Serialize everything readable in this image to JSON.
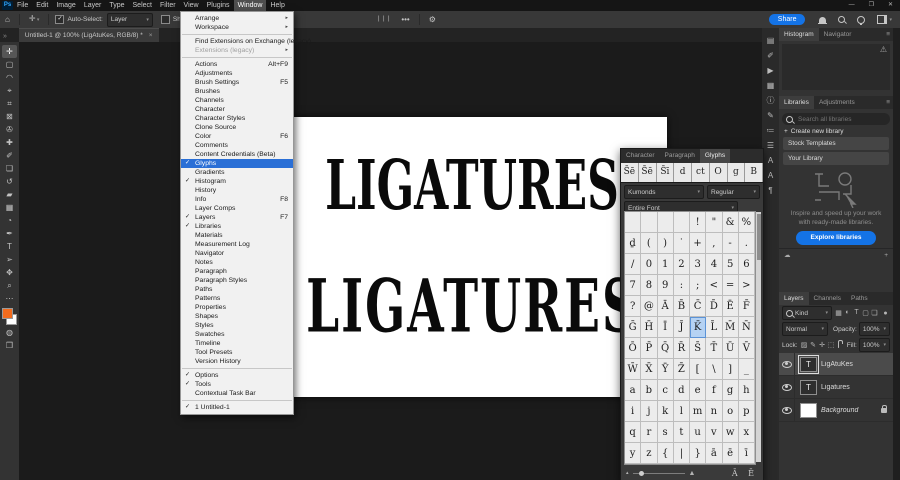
{
  "app": {
    "logo": "Ps"
  },
  "menubar": {
    "items": [
      "File",
      "Edit",
      "Image",
      "Layer",
      "Type",
      "Select",
      "Filter",
      "View",
      "Plugins",
      "Window",
      "Help"
    ],
    "active": "Window"
  },
  "options_bar": {
    "auto_select_label": "Auto-Select:",
    "auto_select_value": "Layer",
    "show_transform_label": "Show Transform Controls",
    "align_icons": "❘❘❘",
    "more_label": "•••",
    "share_label": "Share"
  },
  "document_tab": {
    "title": "Untitled-1 @ 100% (LigAtuKes, RGB/8) *",
    "close": "×"
  },
  "toolbar": {
    "foreground_color": "#f26b1d",
    "background_color": "#ffffff",
    "tools": [
      {
        "name": "move-tool",
        "glyph": "✛"
      },
      {
        "name": "marquee-tool",
        "glyph": "▢"
      },
      {
        "name": "lasso-tool",
        "glyph": "◠"
      },
      {
        "name": "object-selection-tool",
        "glyph": "⌖"
      },
      {
        "name": "crop-tool",
        "glyph": "⌗"
      },
      {
        "name": "frame-tool",
        "glyph": "⊠"
      },
      {
        "name": "eyedropper-tool",
        "glyph": "✇"
      },
      {
        "name": "healing-brush-tool",
        "glyph": "✚"
      },
      {
        "name": "brush-tool",
        "glyph": "✐"
      },
      {
        "name": "clone-stamp-tool",
        "glyph": "❏"
      },
      {
        "name": "history-brush-tool",
        "glyph": "↺"
      },
      {
        "name": "eraser-tool",
        "glyph": "▰"
      },
      {
        "name": "gradient-tool",
        "glyph": "▦"
      },
      {
        "name": "blur-tool",
        "glyph": "◔"
      },
      {
        "name": "pen-tool",
        "glyph": "✒"
      },
      {
        "name": "type-tool",
        "glyph": "T"
      },
      {
        "name": "path-selection-tool",
        "glyph": "➢"
      },
      {
        "name": "hand-tool",
        "glyph": "✥"
      },
      {
        "name": "zoom-tool",
        "glyph": "⌕"
      },
      {
        "name": "edit-toolbar",
        "glyph": "⋯"
      }
    ]
  },
  "canvas": {
    "line1": "LIGATURES",
    "line2": "LIGATURES"
  },
  "window_menu": {
    "items": [
      {
        "label": "Arrange",
        "submenu": true
      },
      {
        "label": "Workspace",
        "submenu": true
      },
      {
        "sep": true
      },
      {
        "label": "Find Extensions on Exchange (legacy)..."
      },
      {
        "label": "Extensions (legacy)",
        "submenu": true,
        "disabled": true
      },
      {
        "sep": true
      },
      {
        "label": "Actions",
        "shortcut": "Alt+F9"
      },
      {
        "label": "Adjustments"
      },
      {
        "label": "Brush Settings",
        "shortcut": "F5"
      },
      {
        "label": "Brushes"
      },
      {
        "label": "Channels"
      },
      {
        "label": "Character"
      },
      {
        "label": "Character Styles"
      },
      {
        "label": "Clone Source"
      },
      {
        "label": "Color",
        "shortcut": "F6"
      },
      {
        "label": "Comments"
      },
      {
        "label": "Content Credentials (Beta)"
      },
      {
        "label": "Glyphs",
        "checked": true,
        "highlighted": true
      },
      {
        "label": "Gradients"
      },
      {
        "label": "Histogram",
        "checked": true
      },
      {
        "label": "History"
      },
      {
        "label": "Info",
        "shortcut": "F8"
      },
      {
        "label": "Layer Comps"
      },
      {
        "label": "Layers",
        "checked": true,
        "shortcut": "F7"
      },
      {
        "label": "Libraries",
        "checked": true
      },
      {
        "label": "Materials"
      },
      {
        "label": "Measurement Log"
      },
      {
        "label": "Navigator"
      },
      {
        "label": "Notes"
      },
      {
        "label": "Paragraph"
      },
      {
        "label": "Paragraph Styles"
      },
      {
        "label": "Paths"
      },
      {
        "label": "Patterns"
      },
      {
        "label": "Properties"
      },
      {
        "label": "Shapes"
      },
      {
        "label": "Styles"
      },
      {
        "label": "Swatches"
      },
      {
        "label": "Timeline"
      },
      {
        "label": "Tool Presets"
      },
      {
        "label": "Version History"
      },
      {
        "sep": true
      },
      {
        "label": "Options",
        "checked": true
      },
      {
        "label": "Tools",
        "checked": true
      },
      {
        "label": "Contextual Task Bar"
      },
      {
        "sep": true
      },
      {
        "label": "1 Untitled-1",
        "checked": true
      }
    ]
  },
  "glyphs_panel": {
    "tabs": [
      "Glyphs",
      "Character",
      "Paragraph"
    ],
    "active_tab": "Glyphs",
    "recent_glyphs": [
      "S̄ē",
      "S̄ē",
      "S̄ī",
      "d",
      "ct",
      "O",
      "g",
      "B"
    ],
    "font_name": "Kumonds",
    "font_style": "Regular",
    "scope": "Entire Font",
    "grid": [
      [
        "",
        "",
        "",
        "",
        "!",
        "\"",
        "&",
        "%"
      ],
      [
        "ḏ",
        "(",
        ")",
        "˙",
        "+",
        ",",
        "-",
        "."
      ],
      [
        "/",
        "0",
        "1",
        "2",
        "3",
        "4",
        "5",
        "6"
      ],
      [
        "7",
        "8",
        "9",
        ":",
        ";",
        "<",
        "=",
        ">"
      ],
      [
        "?",
        "@",
        "Ā",
        "B̄",
        "C̄",
        "D̄",
        "Ē",
        "F̄"
      ],
      [
        "Ḡ",
        "H̄",
        "Ī",
        "J̄",
        "K̄",
        "L̄",
        "M̄",
        "N̄"
      ],
      [
        "Ō",
        "P̄",
        "Q̄",
        "R̄",
        "S̄",
        "T̄",
        "Ū",
        "V̄"
      ],
      [
        "W̄",
        "X̄",
        "Ȳ",
        "Z̄",
        "[",
        "\\",
        "]",
        "_"
      ],
      [
        "a",
        "b",
        "c",
        "d",
        "e",
        "f",
        "g",
        "h"
      ],
      [
        "i",
        "j",
        "k",
        "l",
        "m",
        "n",
        "o",
        "p"
      ],
      [
        "q",
        "r",
        "s",
        "t",
        "u",
        "v",
        "w",
        "x"
      ],
      [
        "y",
        "z",
        "{",
        "|",
        "}",
        "ā",
        "ē",
        "ī"
      ]
    ],
    "selected_cell": {
      "row": 5,
      "col": 4
    },
    "preview_glyphs": "Ā Ē"
  },
  "right_strip": {
    "icons": [
      {
        "name": "collapsed-clone-source-icon",
        "glyph": "▤"
      },
      {
        "name": "collapsed-brush-settings-icon",
        "glyph": "✐"
      },
      {
        "name": "collapsed-actions-icon",
        "glyph": "▶"
      },
      {
        "name": "collapsed-stock-icon",
        "glyph": "▦"
      },
      {
        "name": "collapsed-info-icon",
        "glyph": "ⓘ"
      },
      {
        "name": "collapsed-brush-icon",
        "glyph": "✎"
      },
      {
        "name": "collapsed-properties-icon",
        "glyph": "≔"
      },
      {
        "name": "collapsed-comments-icon",
        "glyph": "☰"
      },
      {
        "name": "collapsed-character-styles-icon",
        "glyph": "A"
      },
      {
        "name": "collapsed-paragraph-styles-icon",
        "glyph": "A"
      },
      {
        "name": "collapsed-paragraph-icon",
        "glyph": "¶"
      }
    ]
  },
  "histogram_panel": {
    "tabs": [
      "Histogram",
      "Navigator"
    ],
    "active_tab": "Histogram",
    "warning_icon": "⚠"
  },
  "libraries_panel": {
    "tabs": [
      "Libraries",
      "Adjustments"
    ],
    "active_tab": "Libraries",
    "search_placeholder": "Search all libraries",
    "create_label": "Create new library",
    "items": [
      "Stock Templates",
      "Your Library"
    ],
    "caption": "Inspire and speed up your work with ready-made libraries.",
    "cta_label": "Explore libraries",
    "accent_color": "#1473e6"
  },
  "layers_panel": {
    "tabs": [
      "Layers",
      "Channels",
      "Paths"
    ],
    "active_tab": "Layers",
    "filter_label": "Kind",
    "filter_icons": [
      {
        "name": "filter-pixel-layers-icon",
        "glyph": "▦"
      },
      {
        "name": "filter-adjustment-layers-icon",
        "glyph": "◐"
      },
      {
        "name": "filter-type-layers-icon",
        "glyph": "T"
      },
      {
        "name": "filter-shape-layers-icon",
        "glyph": "▢"
      },
      {
        "name": "filter-smart-objects-icon",
        "glyph": "❏"
      }
    ],
    "blend_mode": "Normal",
    "opacity_label": "Opacity:",
    "opacity": "100%",
    "lock_label": "Lock:",
    "lock_icons": [
      {
        "name": "lock-transparency-icon",
        "glyph": "▨"
      },
      {
        "name": "lock-pixels-icon",
        "glyph": "✎"
      },
      {
        "name": "lock-position-icon",
        "glyph": "✛"
      },
      {
        "name": "lock-artboard-icon",
        "glyph": "⬚"
      }
    ],
    "fill_label": "Fill:",
    "fill": "100%",
    "layers": [
      {
        "name": "LigAtuKes",
        "type": "text",
        "selected": true
      },
      {
        "name": "Ligatures",
        "type": "text",
        "selected": false
      },
      {
        "name": "Background",
        "type": "background",
        "locked": true
      }
    ]
  }
}
